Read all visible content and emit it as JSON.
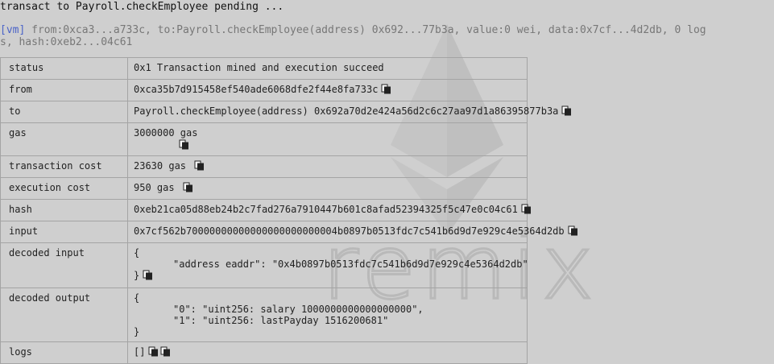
{
  "pending_line": "transact to Payroll.checkEmployee pending ...",
  "log": {
    "tag": "[vm]",
    "line1": " from:0xca3...a733c, to:Payroll.checkEmployee(address) 0x692...77b3a, value:0 wei, data:0x7cf...4d2db, 0 log",
    "line2": "s, hash:0xeb2...04c61"
  },
  "rows": {
    "status": {
      "label": "status",
      "value": "0x1 Transaction mined and execution succeed"
    },
    "from": {
      "label": "from",
      "value": "0xca35b7d915458ef540ade6068dfe2f44e8fa733c"
    },
    "to": {
      "label": "to",
      "value": "Payroll.checkEmployee(address) 0x692a70d2e424a56d2c6c27aa97d1a86395877b3a"
    },
    "gas": {
      "label": "gas",
      "value": "3000000 gas"
    },
    "transaction_cost": {
      "label": "transaction cost",
      "value": "23630 gas"
    },
    "execution_cost": {
      "label": "execution cost",
      "value": "950 gas"
    },
    "hash": {
      "label": "hash",
      "value": "0xeb21ca05d88eb24b2c7fad276a7910447b601c8afad52394325f5c47e0c04c61"
    },
    "input": {
      "label": "input",
      "value": "0x7cf562b70000000000000000000000004b0897b0513fdc7c541b6d9d7e929c4e5364d2db"
    },
    "decoded_input": {
      "label": "decoded input",
      "open": "{",
      "entry": "\"address eaddr\": \"0x4b0897b0513fdc7c541b6d9d7e929c4e5364d2db\"",
      "close": "}"
    },
    "decoded_output": {
      "label": "decoded output",
      "open": "{",
      "entry0": "\"0\": \"uint256: salary 1000000000000000000\",",
      "entry1": "\"1\": \"uint256: lastPayday 1516200681\"",
      "close": "}"
    },
    "logs": {
      "label": "logs",
      "value": "[]"
    }
  },
  "watermark_text": "remix",
  "icons": {
    "copy": "copy-icon",
    "watermark": "ethereum-logo"
  }
}
